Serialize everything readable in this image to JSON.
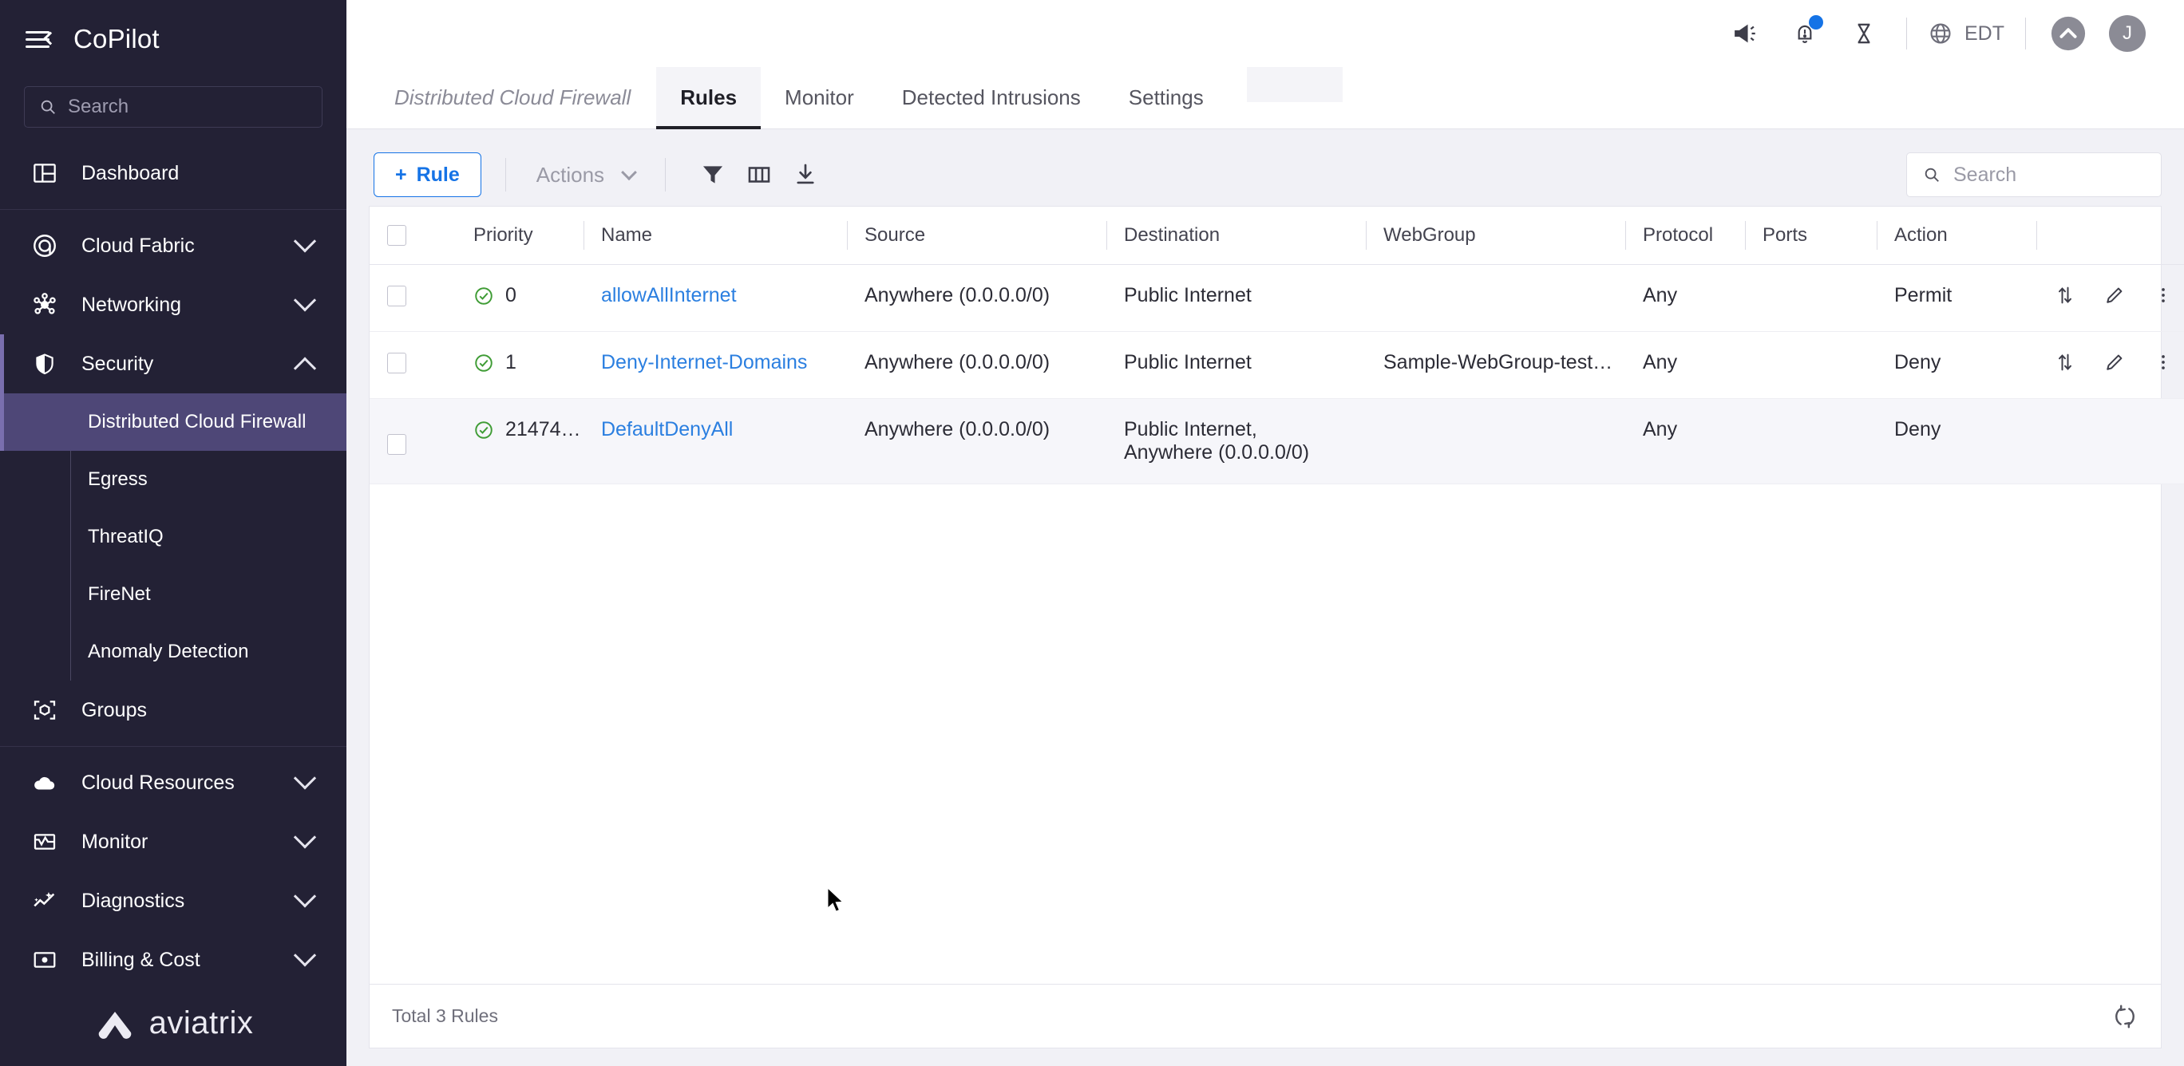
{
  "sidebar": {
    "brand": "CoPilot",
    "menu_icon": "hamburger-collapse-icon",
    "search_placeholder": "Search",
    "items": [
      {
        "label": "Dashboard",
        "icon": "dashboard-icon",
        "expandable": false
      },
      {
        "label": "Cloud Fabric",
        "icon": "cloud-fabric-icon",
        "expandable": true
      },
      {
        "label": "Networking",
        "icon": "networking-icon",
        "expandable": true
      },
      {
        "label": "Security",
        "icon": "shield-icon",
        "expandable": true,
        "expanded": true,
        "active": true
      },
      {
        "label": "Groups",
        "icon": "groups-cube-icon",
        "expandable": false
      },
      {
        "label": "Cloud Resources",
        "icon": "cloud-icon",
        "expandable": true
      },
      {
        "label": "Monitor",
        "icon": "monitor-icon",
        "expandable": true
      },
      {
        "label": "Diagnostics",
        "icon": "diagnostics-icon",
        "expandable": true
      },
      {
        "label": "Billing & Cost",
        "icon": "billing-icon",
        "expandable": true
      }
    ],
    "security_subitems": [
      {
        "label": "Distributed Cloud Firewall",
        "selected": true
      },
      {
        "label": "Egress",
        "selected": false
      },
      {
        "label": "ThreatIQ",
        "selected": false
      },
      {
        "label": "FireNet",
        "selected": false
      },
      {
        "label": "Anomaly Detection",
        "selected": false
      }
    ],
    "footer_logo_text": "aviatrix"
  },
  "topbar": {
    "megaphone_icon": "megaphone-icon",
    "notifications_icon": "bell-alert-icon",
    "notifications_badge": true,
    "hourglass_icon": "hourglass-icon",
    "globe_icon": "globe-icon",
    "timezone": "EDT",
    "collapse_icon": "chevron-up-circle-icon",
    "user_initial": "J"
  },
  "tabbar": {
    "breadcrumb": "Distributed Cloud Firewall",
    "tabs": [
      {
        "label": "Rules",
        "active": true
      },
      {
        "label": "Monitor",
        "active": false
      },
      {
        "label": "Detected Intrusions",
        "active": false
      },
      {
        "label": "Settings",
        "active": false
      }
    ]
  },
  "toolbar": {
    "add_rule_label": "Rule",
    "add_rule_plus": "+",
    "actions_label": "Actions",
    "filter_icon": "filter-funnel-icon",
    "columns_icon": "columns-icon",
    "download_icon": "download-icon",
    "search_placeholder": "Search"
  },
  "table": {
    "columns": [
      "Priority",
      "Name",
      "Source",
      "Destination",
      "WebGroup",
      "Protocol",
      "Ports",
      "Action"
    ],
    "rows": [
      {
        "priority": "0",
        "status_icon": "check-circle-icon",
        "name": "allowAllInternet",
        "source": "Anywhere (0.0.0.0/0)",
        "destination": "Public Internet",
        "webgroup": "",
        "protocol": "Any",
        "ports": "",
        "action": "Permit",
        "shaded": false,
        "row_actions": [
          "sort-updown-icon",
          "edit-pencil-icon",
          "more-vertical-icon"
        ]
      },
      {
        "priority": "1",
        "status_icon": "check-circle-icon",
        "name": "Deny-Internet-Domains",
        "source": "Anywhere (0.0.0.0/0)",
        "destination": "Public Internet",
        "webgroup": "Sample-WebGroup-test…",
        "protocol": "Any",
        "ports": "",
        "action": "Deny",
        "shaded": false,
        "row_actions": [
          "sort-updown-icon",
          "edit-pencil-icon",
          "more-vertical-icon"
        ]
      },
      {
        "priority": "21474…",
        "status_icon": "check-circle-icon",
        "name": "DefaultDenyAll",
        "source": "Anywhere (0.0.0.0/0)",
        "destination": "Public Internet,\nAnywhere (0.0.0.0/0)",
        "webgroup": "",
        "protocol": "Any",
        "ports": "",
        "action": "Deny",
        "shaded": true,
        "row_actions": []
      }
    ],
    "footer_total": "Total 3 Rules",
    "refresh_icon": "refresh-icon"
  },
  "colors": {
    "sidebar_bg": "#232135",
    "sidebar_selected": "#4e4777",
    "accent_bar": "#7a6fae",
    "link_blue": "#2b7fe0",
    "primary_blue": "#1573e6",
    "status_green": "#3f9c35",
    "badge_blue": "#1573e6"
  }
}
